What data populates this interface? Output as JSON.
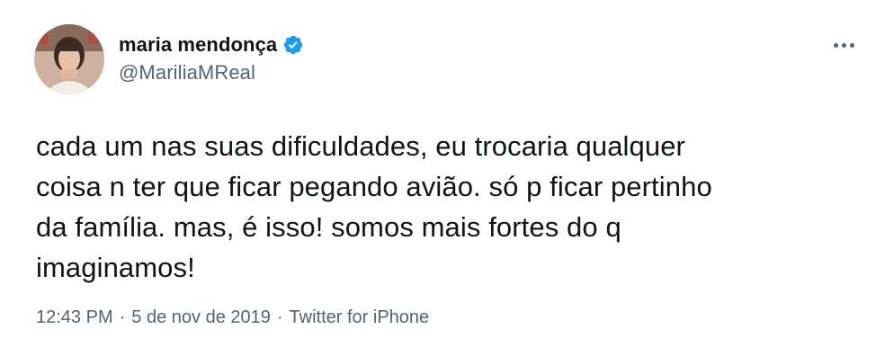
{
  "tweet": {
    "author": {
      "display_name": "maria mendonça",
      "handle": "@MariliaMReal",
      "verified": true,
      "avatar": "profile-photo"
    },
    "text": "cada um nas suas dificuldades, eu trocaria qualquer\ncoisa n ter que ficar pegando avião. só p ficar pertinho\nda família. mas, é isso! somos mais fortes do q\nimaginamos!",
    "time": "12:43 PM",
    "separator": "·",
    "date": "5 de nov de 2019",
    "source": "Twitter for iPhone",
    "more_icon": "more-options-icon"
  },
  "colors": {
    "text_primary": "#0f1419",
    "text_secondary": "#536471",
    "verified_blue": "#1d9bf0",
    "background": "#ffffff"
  }
}
